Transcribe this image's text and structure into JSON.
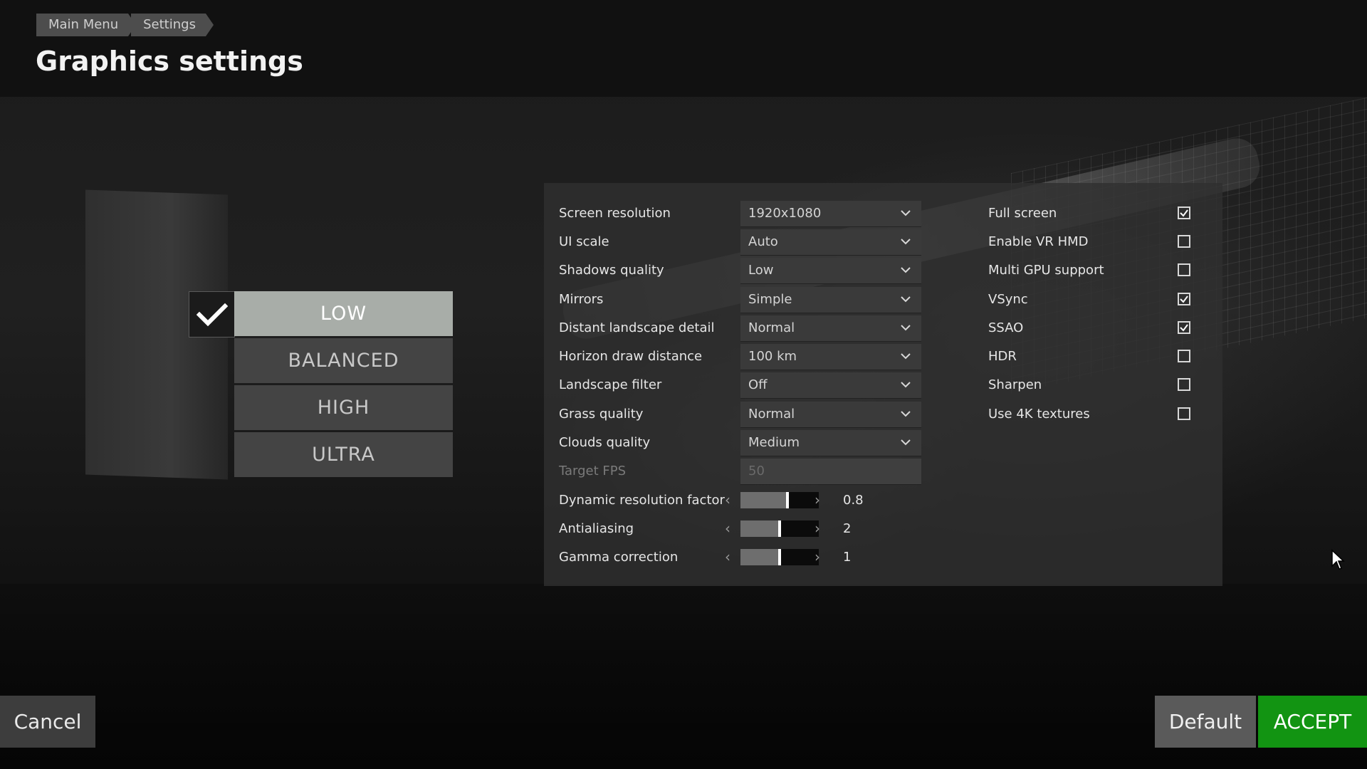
{
  "breadcrumb": [
    "Main Menu",
    "Settings"
  ],
  "page_title": "Graphics settings",
  "presets": {
    "items": [
      "LOW",
      "BALANCED",
      "HIGH",
      "ULTRA"
    ],
    "selected": "LOW"
  },
  "dropdowns": [
    {
      "label": "Screen resolution",
      "value": "1920x1080",
      "enabled": true
    },
    {
      "label": "UI scale",
      "value": "Auto",
      "enabled": true
    },
    {
      "label": "Shadows quality",
      "value": "Low",
      "enabled": true
    },
    {
      "label": "Mirrors",
      "value": "Simple",
      "enabled": true
    },
    {
      "label": "Distant landscape detail",
      "value": "Normal",
      "enabled": true
    },
    {
      "label": "Horizon draw distance",
      "value": "100 km",
      "enabled": true
    },
    {
      "label": "Landscape filter",
      "value": "Off",
      "enabled": true
    },
    {
      "label": "Grass quality",
      "value": "Normal",
      "enabled": true
    },
    {
      "label": "Clouds quality",
      "value": "Medium",
      "enabled": true
    },
    {
      "label": "Target FPS",
      "value": "50",
      "enabled": false
    }
  ],
  "sliders": [
    {
      "label": "Dynamic resolution factor",
      "value": "0.8",
      "level": 0.6
    },
    {
      "label": "Antialiasing",
      "value": "2",
      "level": 0.5
    },
    {
      "label": "Gamma correction",
      "value": "1",
      "level": 0.5
    }
  ],
  "checkboxes": [
    {
      "label": "Full screen",
      "checked": true
    },
    {
      "label": "Enable VR HMD",
      "checked": false
    },
    {
      "label": "Multi GPU support",
      "checked": false
    },
    {
      "label": "VSync",
      "checked": true
    },
    {
      "label": "SSAO",
      "checked": true
    },
    {
      "label": "HDR",
      "checked": false
    },
    {
      "label": "Sharpen",
      "checked": false
    },
    {
      "label": "Use 4K textures",
      "checked": false
    }
  ],
  "buttons": {
    "cancel": "Cancel",
    "default": "Default",
    "accept": "ACCEPT"
  },
  "colors": {
    "accept": "#129412",
    "preset_active": "#a8ada8",
    "preset_inactive": "#444444"
  }
}
